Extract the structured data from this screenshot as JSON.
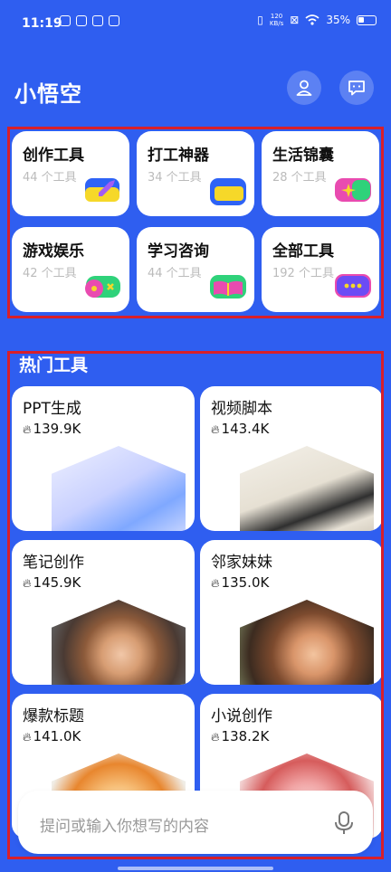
{
  "status_bar": {
    "time": "11:19",
    "net_speed_top": "120",
    "net_speed_unit": "KB/s",
    "battery": "35%"
  },
  "header": {
    "title": "小悟空"
  },
  "categories": [
    {
      "name": "创作工具",
      "count": "44 个工具",
      "icon": "pen-chat-icon",
      "color": "#2e63f6"
    },
    {
      "name": "打工神器",
      "count": "34 个工具",
      "icon": "folder-icon",
      "color": "#2e63f6"
    },
    {
      "name": "生活锦囊",
      "count": "28 个工具",
      "icon": "sparkle-chat-icon",
      "color": "#e94bb0"
    },
    {
      "name": "游戏娱乐",
      "count": "42 个工具",
      "icon": "gamepad-icon",
      "color": "#e94bb0"
    },
    {
      "name": "学习咨询",
      "count": "44 个工具",
      "icon": "book-icon",
      "color": "#2fd27a"
    },
    {
      "name": "全部工具",
      "count": "192 个工具",
      "icon": "more-chat-icon",
      "color": "#6b4cf5"
    }
  ],
  "hot_tools": {
    "title": "热门工具",
    "items": [
      {
        "name": "PPT生成",
        "count": "139.9K",
        "image": "ppt-illustration"
      },
      {
        "name": "视频脚本",
        "count": "143.4K",
        "image": "script-clapperboard-photo"
      },
      {
        "name": "笔记创作",
        "count": "145.9K",
        "image": "woman-portrait-photo"
      },
      {
        "name": "邻家妹妹",
        "count": "135.0K",
        "image": "laughing-girl-photo"
      },
      {
        "name": "爆款标题",
        "count": "141.0K",
        "image": "orange-food-photo"
      },
      {
        "name": "小说创作",
        "count": "138.2K",
        "image": "pink-flower-photo"
      }
    ]
  },
  "input": {
    "placeholder": "提问或输入你想写的内容"
  }
}
